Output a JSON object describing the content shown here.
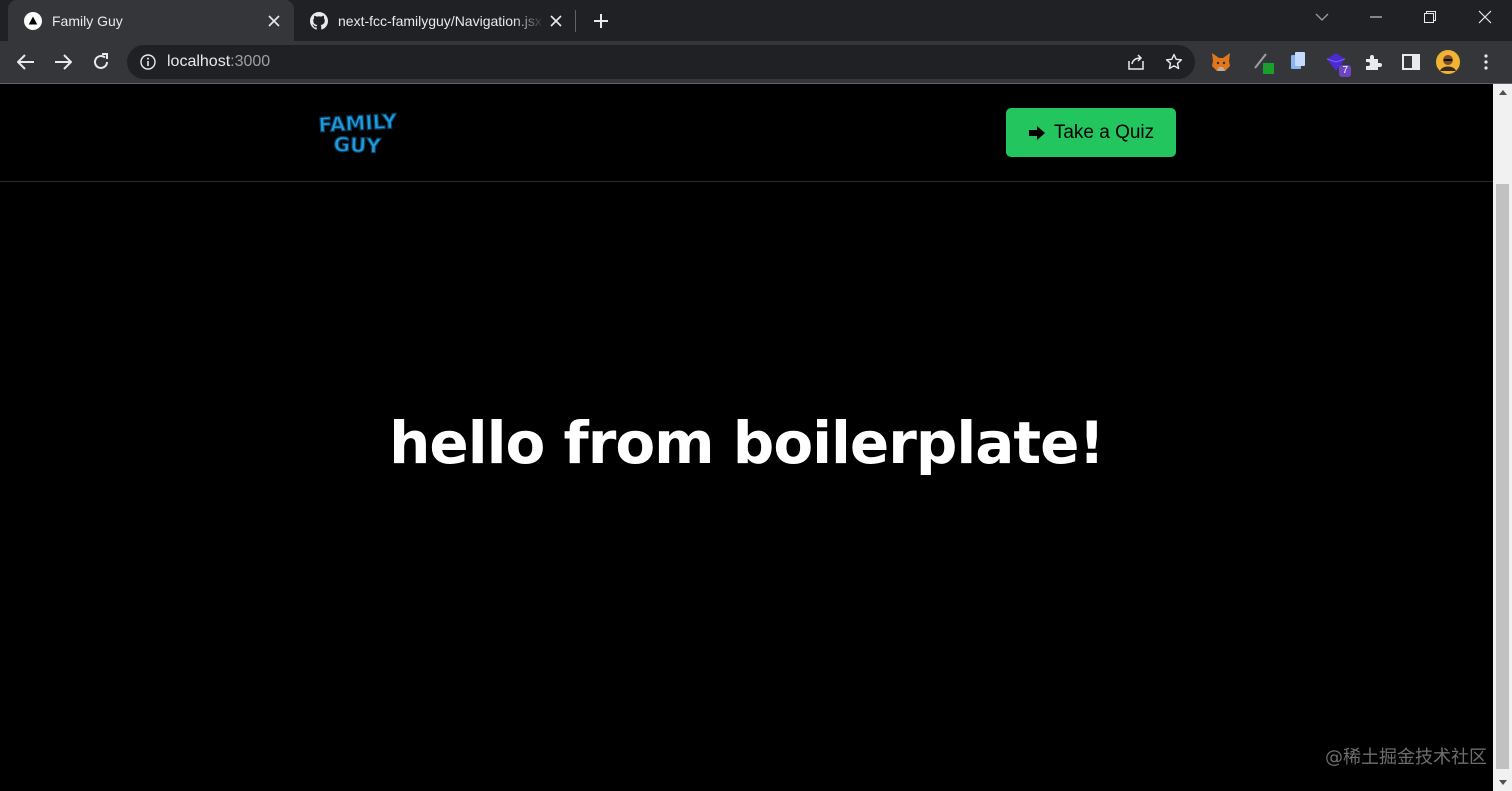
{
  "browser": {
    "tabs": [
      {
        "title": "Family Guy",
        "icon": "vercel-triangle-icon",
        "active": true
      },
      {
        "title": "next-fcc-familyguy/Navigation.jsx",
        "icon": "github-icon",
        "active": false
      }
    ],
    "address": {
      "host": "localhost",
      "port": ":3000"
    },
    "extension_badge": "7"
  },
  "page": {
    "logo_alt": "Family Guy",
    "logo_lines": [
      "FAMILY",
      "GUY"
    ],
    "quiz_button_label": "Take a Quiz",
    "hero_text": "hello from boilerplate!"
  },
  "watermark": "@稀土掘金技术社区",
  "colors": {
    "accent": "#22c55e",
    "logo_blue": "#1e9ed8",
    "page_bg": "#000000",
    "tab_bg": "#202124",
    "toolbar_bg": "#35363a"
  }
}
